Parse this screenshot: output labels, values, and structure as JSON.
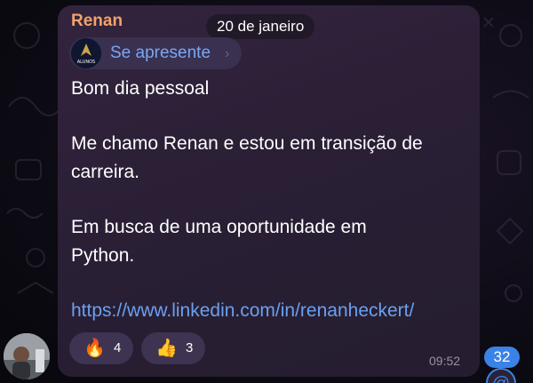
{
  "message": {
    "sender": "Renan",
    "date": "20 de janeiro",
    "reply": {
      "label": "Se apresente",
      "chevron": "›",
      "avatar_text": "ALUNOS"
    },
    "lines": [
      "Bom dia pessoal",
      "Me chamo Renan e estou em transição de",
      "carreira.",
      "Em busca de uma oportunidade em",
      "Python."
    ],
    "link": "https://www.linkedin.com/in/renanheckert/",
    "reactions": [
      {
        "emoji": "🔥",
        "icon": "fire-icon",
        "count": "4"
      },
      {
        "emoji": "👍",
        "icon": "thumbs-up-icon",
        "count": "3"
      }
    ],
    "time": "09:52"
  },
  "unread_count": "32",
  "mention_symbol": "@",
  "colors": {
    "sender": "#f2a26a",
    "link": "#6aa0f0",
    "badge": "#3b82e6"
  }
}
